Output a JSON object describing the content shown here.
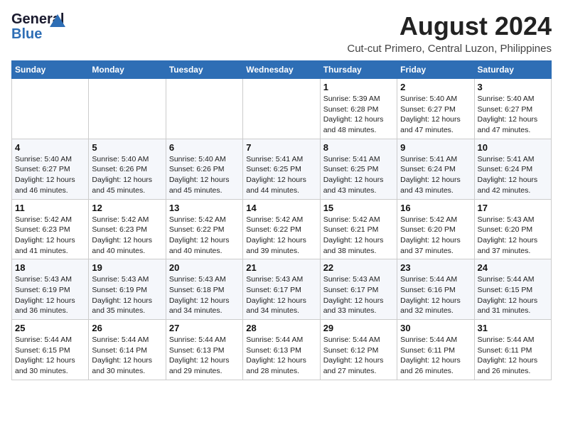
{
  "logo": {
    "general": "General",
    "blue": "Blue"
  },
  "title": {
    "month_year": "August 2024",
    "location": "Cut-cut Primero, Central Luzon, Philippines"
  },
  "weekdays": [
    "Sunday",
    "Monday",
    "Tuesday",
    "Wednesday",
    "Thursday",
    "Friday",
    "Saturday"
  ],
  "weeks": [
    [
      {
        "day": "",
        "info": ""
      },
      {
        "day": "",
        "info": ""
      },
      {
        "day": "",
        "info": ""
      },
      {
        "day": "",
        "info": ""
      },
      {
        "day": "1",
        "info": "Sunrise: 5:39 AM\nSunset: 6:28 PM\nDaylight: 12 hours\nand 48 minutes."
      },
      {
        "day": "2",
        "info": "Sunrise: 5:40 AM\nSunset: 6:27 PM\nDaylight: 12 hours\nand 47 minutes."
      },
      {
        "day": "3",
        "info": "Sunrise: 5:40 AM\nSunset: 6:27 PM\nDaylight: 12 hours\nand 47 minutes."
      }
    ],
    [
      {
        "day": "4",
        "info": "Sunrise: 5:40 AM\nSunset: 6:27 PM\nDaylight: 12 hours\nand 46 minutes."
      },
      {
        "day": "5",
        "info": "Sunrise: 5:40 AM\nSunset: 6:26 PM\nDaylight: 12 hours\nand 45 minutes."
      },
      {
        "day": "6",
        "info": "Sunrise: 5:40 AM\nSunset: 6:26 PM\nDaylight: 12 hours\nand 45 minutes."
      },
      {
        "day": "7",
        "info": "Sunrise: 5:41 AM\nSunset: 6:25 PM\nDaylight: 12 hours\nand 44 minutes."
      },
      {
        "day": "8",
        "info": "Sunrise: 5:41 AM\nSunset: 6:25 PM\nDaylight: 12 hours\nand 43 minutes."
      },
      {
        "day": "9",
        "info": "Sunrise: 5:41 AM\nSunset: 6:24 PM\nDaylight: 12 hours\nand 43 minutes."
      },
      {
        "day": "10",
        "info": "Sunrise: 5:41 AM\nSunset: 6:24 PM\nDaylight: 12 hours\nand 42 minutes."
      }
    ],
    [
      {
        "day": "11",
        "info": "Sunrise: 5:42 AM\nSunset: 6:23 PM\nDaylight: 12 hours\nand 41 minutes."
      },
      {
        "day": "12",
        "info": "Sunrise: 5:42 AM\nSunset: 6:23 PM\nDaylight: 12 hours\nand 40 minutes."
      },
      {
        "day": "13",
        "info": "Sunrise: 5:42 AM\nSunset: 6:22 PM\nDaylight: 12 hours\nand 40 minutes."
      },
      {
        "day": "14",
        "info": "Sunrise: 5:42 AM\nSunset: 6:22 PM\nDaylight: 12 hours\nand 39 minutes."
      },
      {
        "day": "15",
        "info": "Sunrise: 5:42 AM\nSunset: 6:21 PM\nDaylight: 12 hours\nand 38 minutes."
      },
      {
        "day": "16",
        "info": "Sunrise: 5:42 AM\nSunset: 6:20 PM\nDaylight: 12 hours\nand 37 minutes."
      },
      {
        "day": "17",
        "info": "Sunrise: 5:43 AM\nSunset: 6:20 PM\nDaylight: 12 hours\nand 37 minutes."
      }
    ],
    [
      {
        "day": "18",
        "info": "Sunrise: 5:43 AM\nSunset: 6:19 PM\nDaylight: 12 hours\nand 36 minutes."
      },
      {
        "day": "19",
        "info": "Sunrise: 5:43 AM\nSunset: 6:19 PM\nDaylight: 12 hours\nand 35 minutes."
      },
      {
        "day": "20",
        "info": "Sunrise: 5:43 AM\nSunset: 6:18 PM\nDaylight: 12 hours\nand 34 minutes."
      },
      {
        "day": "21",
        "info": "Sunrise: 5:43 AM\nSunset: 6:17 PM\nDaylight: 12 hours\nand 34 minutes."
      },
      {
        "day": "22",
        "info": "Sunrise: 5:43 AM\nSunset: 6:17 PM\nDaylight: 12 hours\nand 33 minutes."
      },
      {
        "day": "23",
        "info": "Sunrise: 5:44 AM\nSunset: 6:16 PM\nDaylight: 12 hours\nand 32 minutes."
      },
      {
        "day": "24",
        "info": "Sunrise: 5:44 AM\nSunset: 6:15 PM\nDaylight: 12 hours\nand 31 minutes."
      }
    ],
    [
      {
        "day": "25",
        "info": "Sunrise: 5:44 AM\nSunset: 6:15 PM\nDaylight: 12 hours\nand 30 minutes."
      },
      {
        "day": "26",
        "info": "Sunrise: 5:44 AM\nSunset: 6:14 PM\nDaylight: 12 hours\nand 30 minutes."
      },
      {
        "day": "27",
        "info": "Sunrise: 5:44 AM\nSunset: 6:13 PM\nDaylight: 12 hours\nand 29 minutes."
      },
      {
        "day": "28",
        "info": "Sunrise: 5:44 AM\nSunset: 6:13 PM\nDaylight: 12 hours\nand 28 minutes."
      },
      {
        "day": "29",
        "info": "Sunrise: 5:44 AM\nSunset: 6:12 PM\nDaylight: 12 hours\nand 27 minutes."
      },
      {
        "day": "30",
        "info": "Sunrise: 5:44 AM\nSunset: 6:11 PM\nDaylight: 12 hours\nand 26 minutes."
      },
      {
        "day": "31",
        "info": "Sunrise: 5:44 AM\nSunset: 6:11 PM\nDaylight: 12 hours\nand 26 minutes."
      }
    ]
  ]
}
